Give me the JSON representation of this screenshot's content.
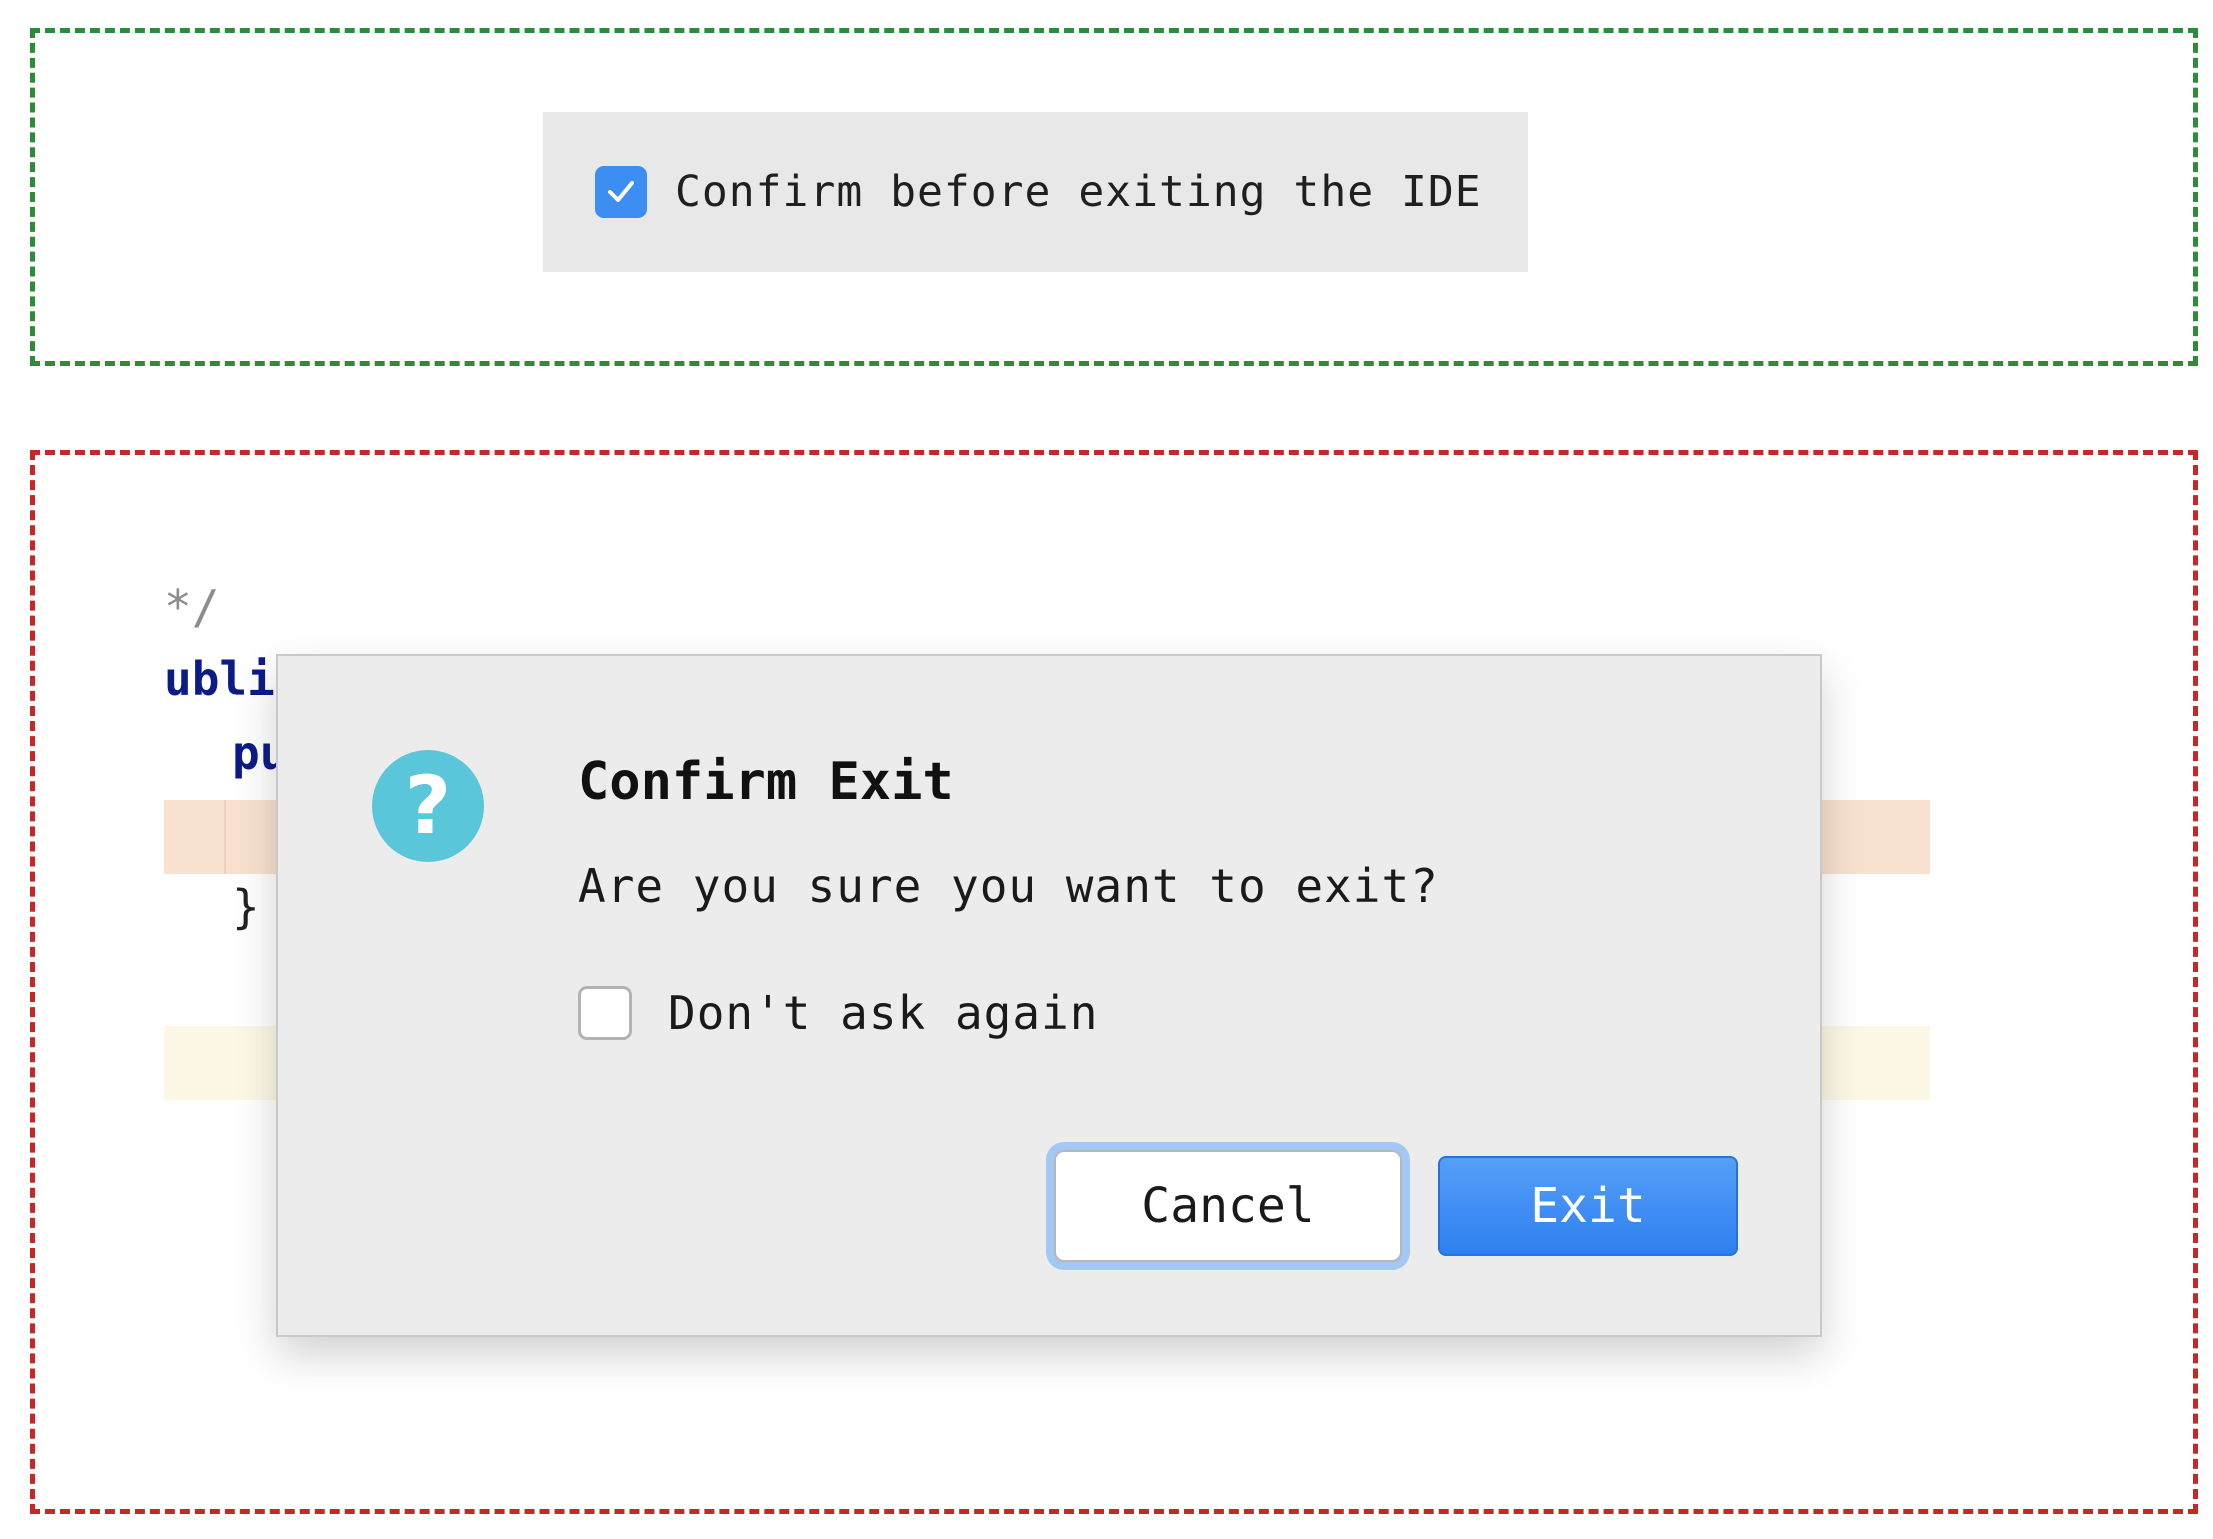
{
  "setting": {
    "checked": true,
    "label": "Confirm before exiting the IDE"
  },
  "editor": {
    "line1": "*/",
    "line2": "ublic",
    "line3": "pu",
    "line4": "}"
  },
  "dialog": {
    "title": "Confirm Exit",
    "message": "Are you sure you want to exit?",
    "checkbox_label": "Don't ask again",
    "checkbox_checked": false,
    "icon": "question-icon",
    "cancel_label": "Cancel",
    "exit_label": "Exit"
  },
  "colors": {
    "accent_blue": "#3c8ef3",
    "icon_teal": "#5ac6d9",
    "frame_green": "#2e8b3a",
    "frame_red": "#c62828"
  }
}
